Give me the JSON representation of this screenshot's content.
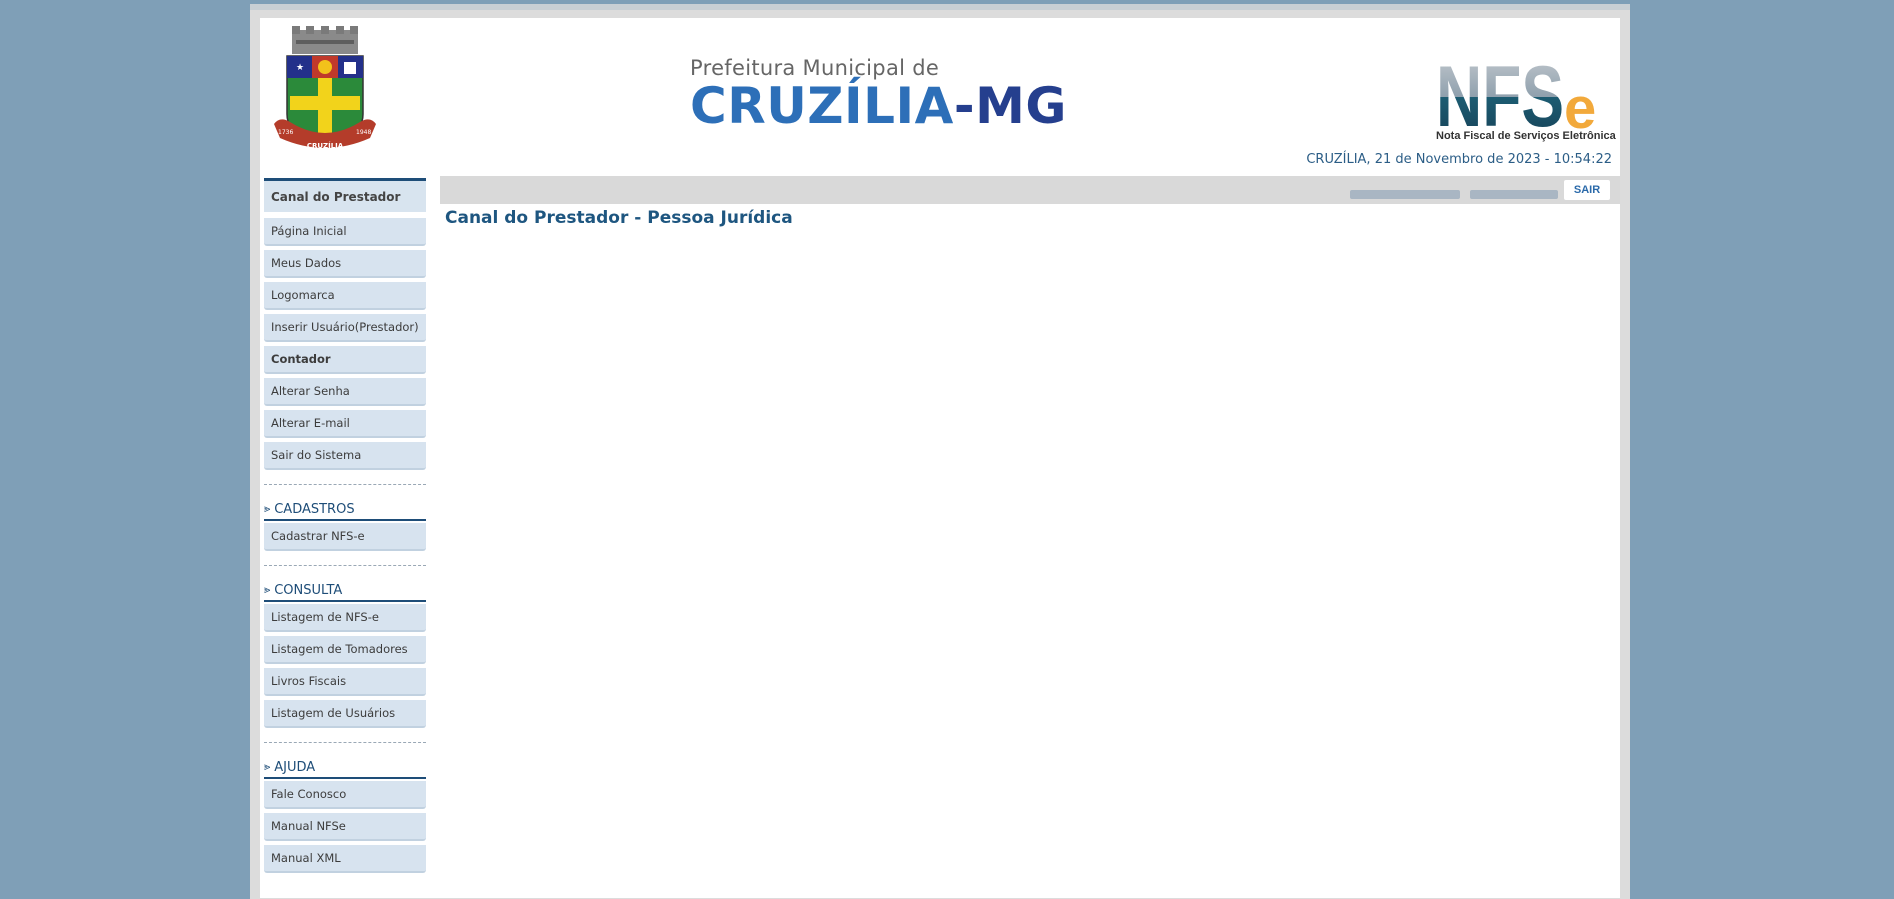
{
  "header": {
    "city_sub": "Prefeitura Municipal de",
    "city_name": "CRUZÍLIA",
    "city_state": "-MG",
    "crest_text": "CRUZÍLIA",
    "crest_year_left": "1736",
    "crest_year_right": "1948",
    "nfse_logo_text": "NFS",
    "nfse_logo_e": "e",
    "nfse_caption": "Nota Fiscal de Serviços Eletrônica",
    "datetime": "CRUZÍLIA, 21 de Novembro de 2023  -  10:54:22"
  },
  "toolbar": {
    "sair_label": "SAIR"
  },
  "main": {
    "title": "Canal do Prestador - Pessoa Jurídica"
  },
  "sidebar": {
    "head": "Canal do Prestador",
    "items": [
      {
        "label": "Página Inicial"
      },
      {
        "label": "Meus Dados"
      },
      {
        "label": "Logomarca"
      },
      {
        "label": "Inserir Usuário(Prestador)"
      },
      {
        "label": "Contador"
      },
      {
        "label": "Alterar Senha"
      },
      {
        "label": "Alterar E-mail"
      },
      {
        "label": "Sair do Sistema"
      }
    ],
    "cadastros": {
      "title": "CADASTROS",
      "items": [
        {
          "label": "Cadastrar NFS-e"
        }
      ]
    },
    "consulta": {
      "title": "CONSULTA",
      "items": [
        {
          "label": "Listagem de NFS-e"
        },
        {
          "label": "Listagem de Tomadores"
        },
        {
          "label": "Livros Fiscais"
        },
        {
          "label": "Listagem de Usuários"
        }
      ]
    },
    "ajuda": {
      "title": "AJUDA",
      "items": [
        {
          "label": "Fale Conosco"
        },
        {
          "label": "Manual NFSe"
        },
        {
          "label": "Manual XML"
        }
      ]
    }
  },
  "colors": {
    "background": "#7f9fb7",
    "accent_dark": "#1e4d78",
    "menu_bg": "#d7e3ef",
    "city_blue": "#2d6fb8",
    "nfse_orange": "#f2a93b"
  },
  "icons": {
    "crest": "municipal-coat-of-arms",
    "section_chevron": "double-chevron-right-icon"
  }
}
